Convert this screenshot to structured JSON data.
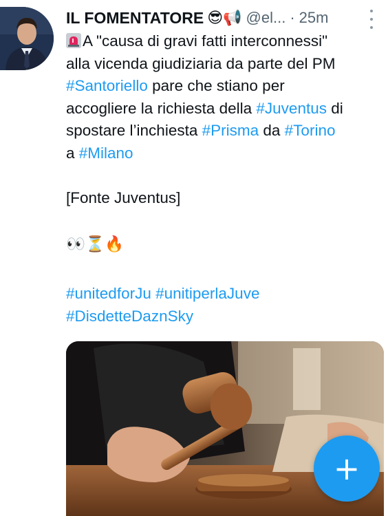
{
  "tweet": {
    "author": {
      "name": "IL FOMENTATORE",
      "emojis": "😎📢",
      "handle": "@el...",
      "time_separator": "·",
      "time": "25m"
    },
    "text": {
      "line1_rest": "A \"causa di gravi fatti interconnessi\"",
      "line2": "alla vicenda giudiziaria da parte del PM",
      "line3_tag": "#Santoriello",
      "line3_rest": " pare che stiano per",
      "line4_pre": "accogliere la richiesta della ",
      "line4_tag": "#Juventus",
      "line4_post": " di",
      "line5_pre": "spostare l’inchiesta ",
      "line5_tag1": "#Prisma",
      "line5_mid": " da ",
      "line5_tag2": "#Torino",
      "line6_pre": "a ",
      "line6_tag": "#Milano",
      "source": "[Fonte Juventus]",
      "emoji_line": "👀⏳🔥",
      "tags_line1_a": "#unitedforJu",
      "tags_line1_b": "#unitiperlaJuve",
      "tags_line2": "#DisdetteDaznSky"
    }
  },
  "compose_button": {
    "label": "+"
  },
  "colors": {
    "link": "#1d9bf0",
    "text": "#0f1419",
    "secondary": "#536471",
    "fab": "#1d9bf0"
  },
  "icons": {
    "more": "more-vertical-icon",
    "siren": "siren-icon",
    "compose": "plus-icon"
  }
}
